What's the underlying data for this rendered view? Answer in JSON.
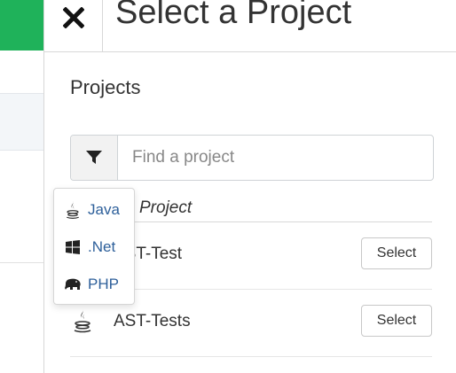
{
  "panel": {
    "title": "Select a Project",
    "section_title": "Projects",
    "search": {
      "placeholder": "Find a project",
      "value": ""
    },
    "column_header": "Project"
  },
  "filter_menu": {
    "items": [
      {
        "label": "Java",
        "icon": "java-icon"
      },
      {
        "label": ".Net",
        "icon": "windows-icon"
      },
      {
        "label": "PHP",
        "icon": "php-elephant-icon"
      }
    ]
  },
  "projects": [
    {
      "name": "AST-Test",
      "icon": "java-icon",
      "action": "Select"
    },
    {
      "name": "AST-Tests",
      "icon": "java-icon",
      "action": "Select"
    }
  ],
  "colors": {
    "accent_green": "#1fb25a",
    "link_blue": "#2d5f9a"
  }
}
